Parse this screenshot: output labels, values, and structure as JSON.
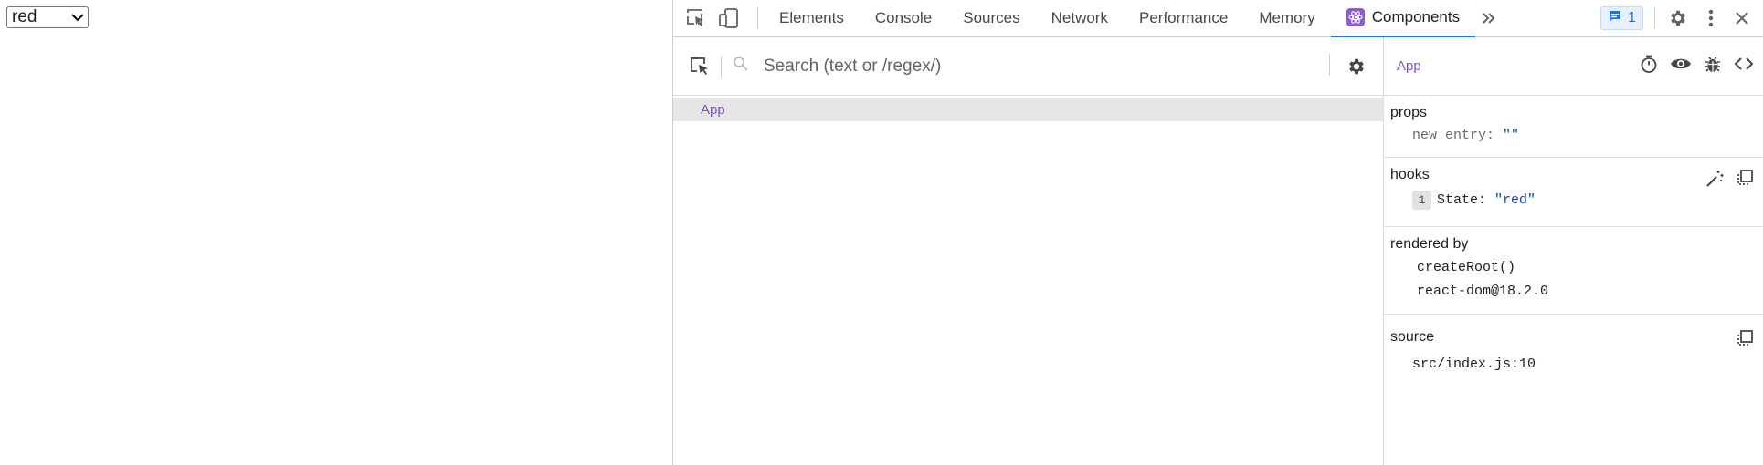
{
  "page": {
    "select_value": "red"
  },
  "devtools": {
    "tabs": [
      "Elements",
      "Console",
      "Sources",
      "Network",
      "Performance",
      "Memory",
      "Components"
    ],
    "active_tab": "Components",
    "issues_count": "1",
    "accent_color": "#1a73e8"
  },
  "tree": {
    "search_placeholder": "Search (text or /regex/)",
    "rows": [
      "App"
    ]
  },
  "inspector": {
    "component_name": "App",
    "props": {
      "title": "props",
      "key": "new entry",
      "value": "\"\""
    },
    "hooks": {
      "title": "hooks",
      "index": "1",
      "key": "State",
      "value": "\"red\""
    },
    "rendered_by": {
      "title": "rendered by",
      "items": [
        "createRoot()",
        "react-dom@18.2.0"
      ]
    },
    "source": {
      "title": "source",
      "location": "src/index.js:10"
    }
  }
}
